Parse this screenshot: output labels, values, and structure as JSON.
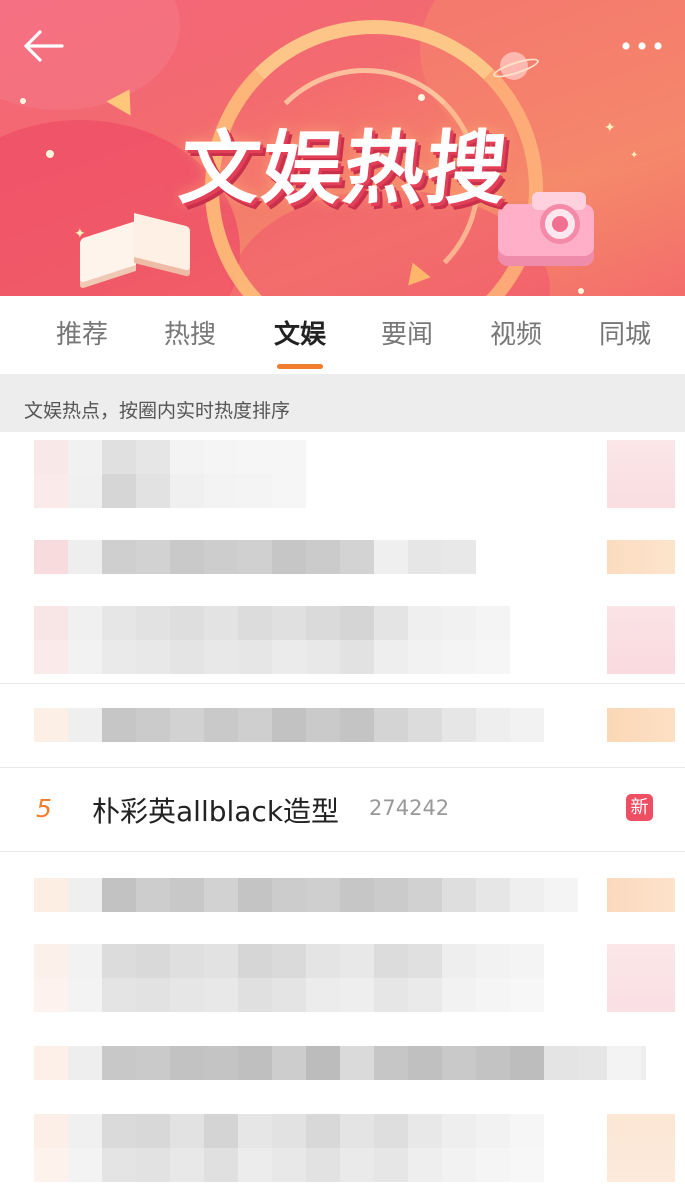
{
  "banner": {
    "title": "文娱热搜",
    "back_icon": "arrow-left-icon",
    "more_icon": "more-dots-icon"
  },
  "tabs": [
    {
      "label": "推荐",
      "active": false
    },
    {
      "label": "热搜",
      "active": false
    },
    {
      "label": "文娱",
      "active": true
    },
    {
      "label": "要闻",
      "active": false
    },
    {
      "label": "视频",
      "active": false
    },
    {
      "label": "同城",
      "active": false
    }
  ],
  "subheader": {
    "text": "文娱热点，按圈内实时热度排序"
  },
  "list": {
    "visible_item": {
      "rank": "5",
      "title": "朴彩英allblack造型",
      "heat": "274242",
      "badge": "新"
    }
  },
  "colors": {
    "accent": "#f27d2d",
    "badge_new": "#ee4f63",
    "banner": "#f4657a",
    "subheader_bg": "#ededed"
  }
}
